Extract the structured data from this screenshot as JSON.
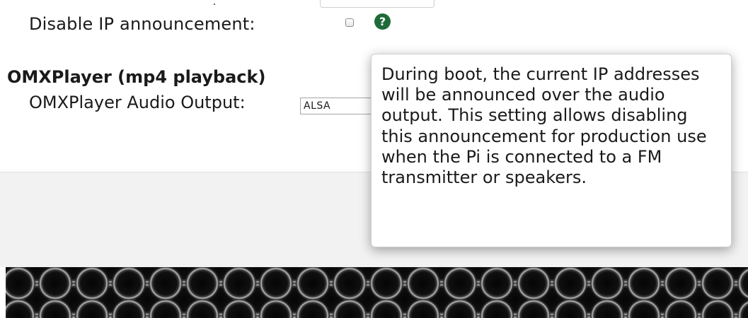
{
  "settings": {
    "disable_ip_label": "Disable IP announcement:",
    "disable_ip_checked": false,
    "help_glyph": "?"
  },
  "omxplayer": {
    "section_title": "OMXPlayer (mp4 playback)",
    "audio_output_label": "OMXPlayer Audio Output:",
    "audio_output_value": "ALSA"
  },
  "tooltip": {
    "text": "During boot, the current IP addresses will be announced over the audio output. This setting allows disabling this announcement for production use when the Pi is connected to a FM transmitter or speakers."
  },
  "icons": {
    "help": "question-circle-icon"
  },
  "colors": {
    "help_icon_bg": "#1e6b3a",
    "grey_band": "#f2f2f2",
    "grille": "#0d0d0d"
  }
}
